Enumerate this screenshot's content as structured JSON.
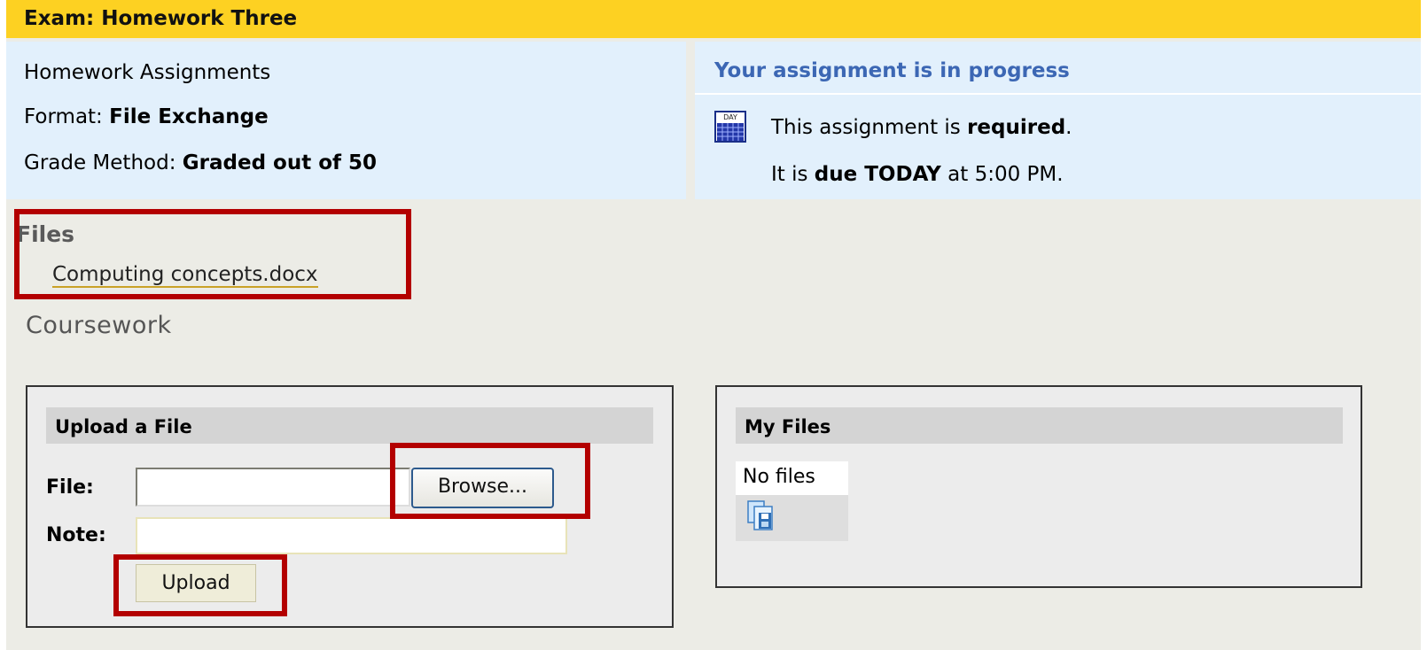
{
  "title": "Exam: Homework Three",
  "info": {
    "category": "Homework Assignments",
    "format_label": "Format: ",
    "format_value": "File Exchange",
    "grade_label": "Grade Method: ",
    "grade_value": "Graded out of 50"
  },
  "status": {
    "heading": "Your assignment is in progress",
    "required_prefix": "This assignment is ",
    "required_word": "required",
    "required_suffix": ".",
    "due_prefix": "It is ",
    "due_word": "due TODAY",
    "due_suffix": " at 5:00 PM.",
    "calendar_icon": "calendar-icon",
    "calendar_icon_text": "DAY"
  },
  "files": {
    "heading": "Files",
    "items": [
      "Computing concepts.docx"
    ]
  },
  "coursework": {
    "heading": "Coursework"
  },
  "upload_panel": {
    "title": "Upload a File",
    "file_label": "File:",
    "note_label": "Note:",
    "file_value": "",
    "note_value": "",
    "browse_label": "Browse...",
    "upload_label": "Upload"
  },
  "my_files_panel": {
    "title": "My Files",
    "empty_text": "No files",
    "icon": "copy-files-icon"
  },
  "colors": {
    "title_bar": "#fdd122",
    "info_bg": "#e2f0fc",
    "status_heading": "#3c67b4",
    "annotation": "#b30000"
  }
}
